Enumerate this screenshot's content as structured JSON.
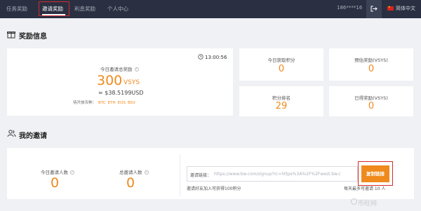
{
  "nav": {
    "tabs": [
      "任务奖励",
      "邀请奖励",
      "利息奖励",
      "个人中心"
    ],
    "active_index": 1,
    "user": "186****16",
    "language": "简体中文"
  },
  "rewards": {
    "title": "奖励信息",
    "time": "13:00:56",
    "today_total_label": "今日邀请总奖励",
    "amount": "300",
    "unit": "VSYS",
    "usd": "≈ $38.5199USD",
    "coins_label": "待开放币种：",
    "coins": [
      "BTC",
      "ETH",
      "EOS",
      "BSV"
    ],
    "stats": [
      {
        "label": "今日获取积分",
        "value": "0"
      },
      {
        "label": "预估奖励(VSYS)",
        "value": "0"
      },
      {
        "label": "积分排名",
        "value": "29"
      },
      {
        "label": "已得奖励(VSYS)",
        "value": "0"
      }
    ]
  },
  "invites": {
    "title": "我的邀请",
    "today_count_label": "今日邀请人数",
    "today_count": "0",
    "total_count_label": "总邀请人数",
    "total_count": "0",
    "link_label": "邀请链接：",
    "link_url": "https://www.bw.com/signup?rc=https%3A%2F%2Fwest.bw.c",
    "copy_label": "复制链接",
    "note_left": "邀请好友加入可获得100积分",
    "note_right": "每天最多可邀请 10 人"
  },
  "watermark": "币旺网",
  "colors": {
    "accent": "#f08a1c",
    "nav_bg": "#2a3042",
    "highlight": "#d62b2b"
  },
  "icons": [
    "clock-icon",
    "gift-icon",
    "users-icon",
    "logout-icon",
    "flag-cn-icon",
    "help-icon"
  ]
}
